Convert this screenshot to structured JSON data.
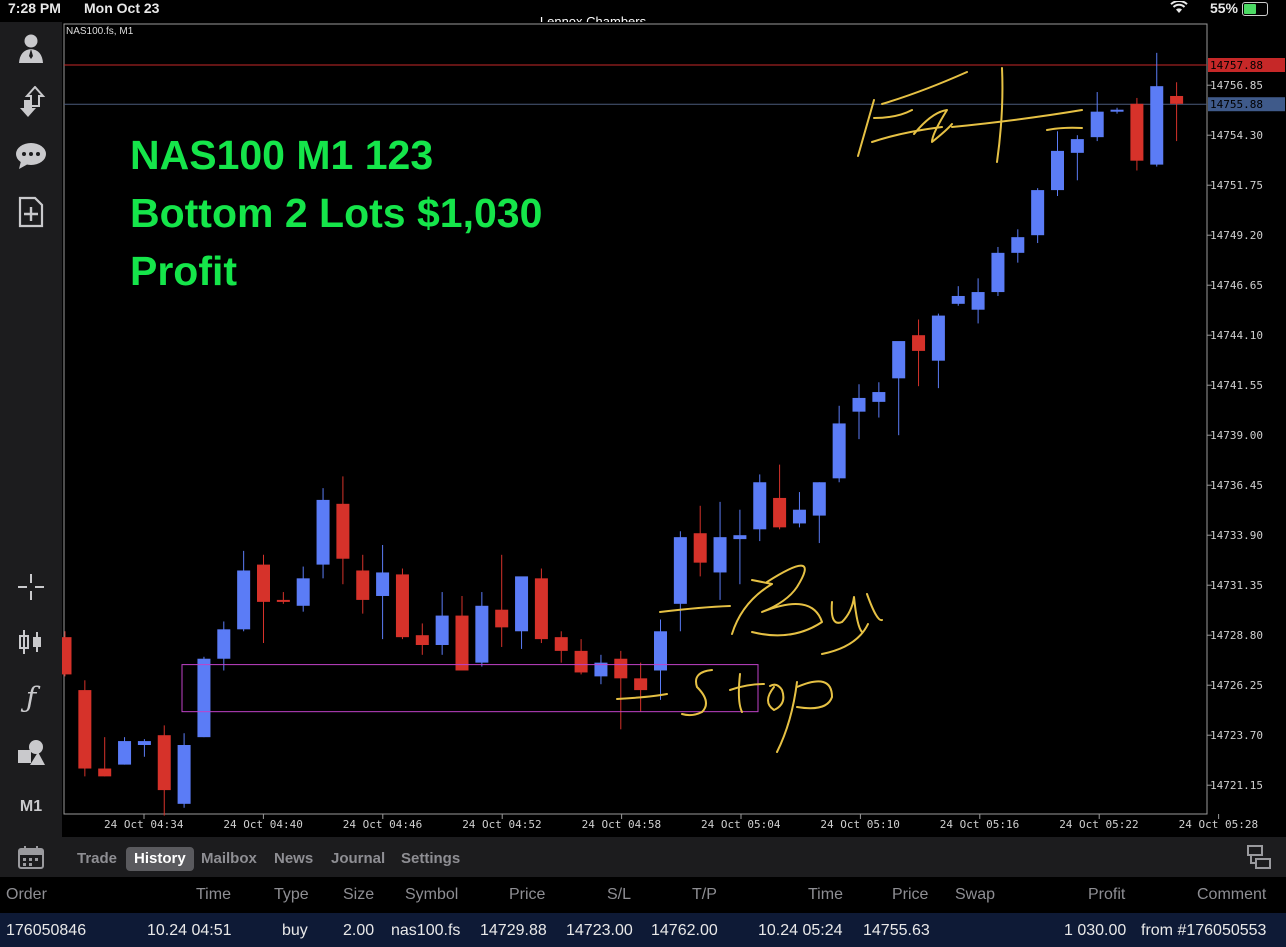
{
  "status_bar": {
    "time": "7:28 PM",
    "date": "Mon Oct 23",
    "battery": "55%"
  },
  "account_name": "Lennox Chambers",
  "toolbar": {
    "timeframe_label": "M1"
  },
  "chart": {
    "symbol_label": "NAS100.fs, M1",
    "overlay_lines": [
      "NAS100 M1 123",
      "Bottom 2 Lots $1,030",
      "Profit"
    ],
    "annotations": [
      "Exit",
      "Buy",
      "Stop"
    ],
    "colors": {
      "bull": "#5b7cf6",
      "bear": "#d6322a",
      "ask_line": "#c62828",
      "bid_line": "#4a5a7a",
      "box": "#c042c8",
      "overlay_text": "#15e54a",
      "annotation": "#e6c144"
    },
    "price_ticks": [
      "14756.85",
      "14754.30",
      "14751.75",
      "14749.20",
      "14746.65",
      "14744.10",
      "14741.55",
      "14739.00",
      "14736.45",
      "14733.90",
      "14731.35",
      "14728.80",
      "14726.25",
      "14723.70",
      "14721.15"
    ],
    "time_ticks": [
      "24 Oct 04:34",
      "24 Oct 04:40",
      "24 Oct 04:46",
      "24 Oct 04:52",
      "24 Oct 04:58",
      "24 Oct 05:04",
      "24 Oct 05:10",
      "24 Oct 05:16",
      "24 Oct 05:22",
      "24 Oct 05:28"
    ],
    "ask_price": "14757.88",
    "bid_price": "14755.88"
  },
  "chart_data": {
    "type": "candlestick",
    "title": "",
    "ylim": [
      14719.5,
      14758.9
    ],
    "candles": [
      {
        "o": 14728.7,
        "h": 14729.0,
        "l": 14726.7,
        "c": 14726.8
      },
      {
        "o": 14726.0,
        "h": 14726.5,
        "l": 14721.6,
        "c": 14722.0
      },
      {
        "o": 14722.0,
        "h": 14723.6,
        "l": 14721.6,
        "c": 14721.6
      },
      {
        "o": 14722.2,
        "h": 14723.6,
        "l": 14722.2,
        "c": 14723.4
      },
      {
        "o": 14723.2,
        "h": 14723.5,
        "l": 14722.6,
        "c": 14723.4
      },
      {
        "o": 14723.7,
        "h": 14724.2,
        "l": 14719.6,
        "c": 14720.9
      },
      {
        "o": 14720.2,
        "h": 14723.8,
        "l": 14720.0,
        "c": 14723.2
      },
      {
        "o": 14723.6,
        "h": 14727.7,
        "l": 14723.6,
        "c": 14727.6
      },
      {
        "o": 14727.6,
        "h": 14729.5,
        "l": 14727.0,
        "c": 14729.1
      },
      {
        "o": 14729.1,
        "h": 14733.1,
        "l": 14729.0,
        "c": 14732.1
      },
      {
        "o": 14732.4,
        "h": 14732.9,
        "l": 14728.4,
        "c": 14730.5
      },
      {
        "o": 14730.6,
        "h": 14731.0,
        "l": 14730.4,
        "c": 14730.5
      },
      {
        "o": 14730.3,
        "h": 14732.3,
        "l": 14730.0,
        "c": 14731.7
      },
      {
        "o": 14732.4,
        "h": 14736.3,
        "l": 14731.7,
        "c": 14735.7
      },
      {
        "o": 14735.5,
        "h": 14736.9,
        "l": 14731.4,
        "c": 14732.7
      },
      {
        "o": 14732.1,
        "h": 14732.9,
        "l": 14729.9,
        "c": 14730.6
      },
      {
        "o": 14730.8,
        "h": 14733.4,
        "l": 14728.6,
        "c": 14732.0
      },
      {
        "o": 14731.9,
        "h": 14732.2,
        "l": 14728.6,
        "c": 14728.7
      },
      {
        "o": 14728.8,
        "h": 14729.4,
        "l": 14727.8,
        "c": 14728.3
      },
      {
        "o": 14728.3,
        "h": 14731.0,
        "l": 14727.8,
        "c": 14729.8
      },
      {
        "o": 14729.8,
        "h": 14730.8,
        "l": 14727.0,
        "c": 14727.0
      },
      {
        "o": 14727.4,
        "h": 14731.0,
        "l": 14727.2,
        "c": 14730.3
      },
      {
        "o": 14730.1,
        "h": 14732.9,
        "l": 14728.2,
        "c": 14729.2
      },
      {
        "o": 14729.0,
        "h": 14730.2,
        "l": 14728.1,
        "c": 14731.8
      },
      {
        "o": 14731.7,
        "h": 14732.2,
        "l": 14728.4,
        "c": 14728.6
      },
      {
        "o": 14728.7,
        "h": 14729.0,
        "l": 14727.4,
        "c": 14728.0
      },
      {
        "o": 14728.0,
        "h": 14728.6,
        "l": 14726.8,
        "c": 14726.9
      },
      {
        "o": 14726.7,
        "h": 14727.8,
        "l": 14726.3,
        "c": 14727.4
      },
      {
        "o": 14727.6,
        "h": 14728.0,
        "l": 14724.0,
        "c": 14726.6
      },
      {
        "o": 14726.6,
        "h": 14727.4,
        "l": 14724.9,
        "c": 14726.0
      },
      {
        "o": 14727.0,
        "h": 14729.6,
        "l": 14725.5,
        "c": 14729.0
      },
      {
        "o": 14730.4,
        "h": 14734.1,
        "l": 14729.0,
        "c": 14733.8
      },
      {
        "o": 14734.0,
        "h": 14735.4,
        "l": 14731.8,
        "c": 14732.5
      },
      {
        "o": 14732.0,
        "h": 14735.6,
        "l": 14730.6,
        "c": 14733.8
      },
      {
        "o": 14733.7,
        "h": 14735.2,
        "l": 14731.4,
        "c": 14733.9
      },
      {
        "o": 14734.2,
        "h": 14737.0,
        "l": 14733.6,
        "c": 14736.6
      },
      {
        "o": 14735.8,
        "h": 14737.5,
        "l": 14734.2,
        "c": 14734.3
      },
      {
        "o": 14734.5,
        "h": 14736.1,
        "l": 14734.3,
        "c": 14735.2
      },
      {
        "o": 14734.9,
        "h": 14736.6,
        "l": 14733.5,
        "c": 14736.6
      },
      {
        "o": 14736.8,
        "h": 14740.5,
        "l": 14736.6,
        "c": 14739.6
      },
      {
        "o": 14740.2,
        "h": 14741.6,
        "l": 14738.8,
        "c": 14740.9
      },
      {
        "o": 14740.7,
        "h": 14741.7,
        "l": 14739.9,
        "c": 14741.2
      },
      {
        "o": 14741.9,
        "h": 14743.1,
        "l": 14739.0,
        "c": 14743.8
      },
      {
        "o": 14744.1,
        "h": 14744.9,
        "l": 14741.5,
        "c": 14743.3
      },
      {
        "o": 14742.8,
        "h": 14745.2,
        "l": 14741.4,
        "c": 14745.1
      },
      {
        "o": 14745.7,
        "h": 14746.6,
        "l": 14745.6,
        "c": 14746.1
      },
      {
        "o": 14745.4,
        "h": 14747.0,
        "l": 14744.7,
        "c": 14746.3
      },
      {
        "o": 14746.3,
        "h": 14748.6,
        "l": 14746.1,
        "c": 14748.3
      },
      {
        "o": 14748.3,
        "h": 14749.5,
        "l": 14747.8,
        "c": 14749.1
      },
      {
        "o": 14749.2,
        "h": 14751.6,
        "l": 14748.8,
        "c": 14751.5
      },
      {
        "o": 14751.5,
        "h": 14754.5,
        "l": 14751.2,
        "c": 14753.5
      },
      {
        "o": 14753.4,
        "h": 14754.3,
        "l": 14752.0,
        "c": 14754.1
      },
      {
        "o": 14754.2,
        "h": 14756.5,
        "l": 14754.0,
        "c": 14755.5
      },
      {
        "o": 14755.5,
        "h": 14755.7,
        "l": 14755.4,
        "c": 14755.6
      },
      {
        "o": 14755.9,
        "h": 14756.2,
        "l": 14752.5,
        "c": 14753.0
      },
      {
        "o": 14752.8,
        "h": 14758.5,
        "l": 14752.7,
        "c": 14756.8
      },
      {
        "o": 14756.3,
        "h": 14757.0,
        "l": 14754.0,
        "c": 14755.9
      }
    ],
    "buy_price": 14729.88,
    "stop_price": 14723.0
  },
  "tabs": [
    "Trade",
    "History",
    "Mailbox",
    "News",
    "Journal",
    "Settings"
  ],
  "active_tab": "History",
  "history_table": {
    "headers": [
      "Order",
      "Time",
      "Type",
      "Size",
      "Symbol",
      "Price",
      "S/L",
      "T/P",
      "Time",
      "Price",
      "Swap",
      "Profit",
      "Comment"
    ],
    "rows": [
      [
        "176050846",
        "10.24 04:51",
        "buy",
        "2.00",
        "nas100.fs",
        "14729.88",
        "14723.00",
        "14762.00",
        "10.24 05:24",
        "14755.63",
        "",
        "1 030.00",
        "from #176050553"
      ]
    ]
  }
}
